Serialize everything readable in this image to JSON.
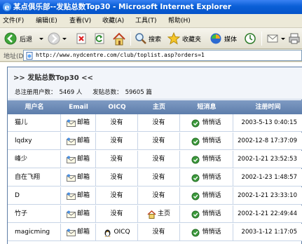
{
  "window": {
    "title": "某点俱乐部--发贴总数Top30 - Microsoft Internet Explorer"
  },
  "menu": {
    "items": [
      "文件(F)",
      "编辑(E)",
      "查看(V)",
      "收藏(A)",
      "工具(T)",
      "帮助(H)"
    ]
  },
  "toolbar": {
    "back_label": "后退",
    "search_label": "搜索",
    "favorites_label": "收藏夹",
    "media_label": "媒体"
  },
  "address": {
    "label": "地址(D)",
    "url": "http://www.nydcentre.com/club/toplist.asp?orders=1"
  },
  "page": {
    "heading": ">> 发贴总数Top30 <<",
    "stats_users_label": "总注册用户数：",
    "stats_users_value": "5469 人",
    "stats_posts_label": "发贴总数：",
    "stats_posts_value": "59605 篇",
    "columns": [
      "用户名",
      "Email",
      "OICQ",
      "主页",
      "短消息",
      "注册时间"
    ],
    "rows": [
      {
        "user": "猫儿",
        "email": "邮箱",
        "oicq": "没有",
        "home": "没有",
        "msg": "悄悄话",
        "time": "2003-5-13 0:40:15"
      },
      {
        "user": "lqdxy",
        "email": "邮箱",
        "oicq": "没有",
        "home": "没有",
        "msg": "悄悄话",
        "time": "2002-12-8 17:37:09"
      },
      {
        "user": "峰少",
        "email": "邮箱",
        "oicq": "没有",
        "home": "没有",
        "msg": "悄悄话",
        "time": "2002-1-21 23:52:53"
      },
      {
        "user": "自在飞翔",
        "email": "邮箱",
        "oicq": "没有",
        "home": "没有",
        "msg": "悄悄话",
        "time": "2002-1-23 1:48:57"
      },
      {
        "user": "D",
        "email": "邮箱",
        "oicq": "没有",
        "home": "没有",
        "msg": "悄悄话",
        "time": "2002-1-21 23:33:10"
      },
      {
        "user": "竹子",
        "email": "邮箱",
        "oicq": "没有",
        "home": "主页",
        "msg": "悄悄话",
        "time": "2002-1-21 22:49:44"
      },
      {
        "user": "magicming",
        "email": "邮箱",
        "oicq": "OICQ",
        "home": "没有",
        "msg": "悄悄话",
        "time": "2003-1-12 1:17:05"
      }
    ]
  },
  "icons": {
    "ie": "ie-logo-icon",
    "back": "back-arrow-icon",
    "forward": "forward-arrow-icon",
    "stop": "stop-icon",
    "refresh": "refresh-icon",
    "home": "home-icon",
    "search": "search-icon",
    "favorites": "favorites-star-icon",
    "media": "media-icon",
    "history": "history-icon",
    "mail": "mail-icon",
    "print": "printer-icon"
  },
  "colors": {
    "titlebar": "#0a5fd6",
    "header": "#6886b5",
    "border": "#c7d4e6"
  }
}
